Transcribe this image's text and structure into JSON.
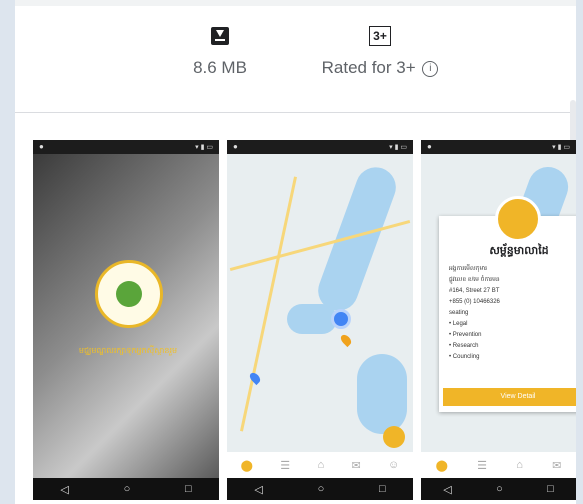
{
  "stats": {
    "size_value": "8.6 MB",
    "rating_badge": "3+",
    "rating_text": "Rated for 3+",
    "info_glyph": "i"
  },
  "shot1": {
    "subtitle": "មជ្ឈមណ្ឌលរក្សាទុកអ្នកស៊ីស្ថានរួម"
  },
  "shot3": {
    "title": "សម្ព័ន្ធមាលាដៃ",
    "lines": [
      "អង្គការមើលកុមារ",
      "ផ្លូវលេខ ខ/មេ ចំការមន",
      "#164, Street 27 BT",
      "+855 (0) 10466326",
      "seating",
      "• Legal",
      "• Prevention",
      "• Research",
      "• Councling"
    ],
    "button": "View Detail"
  },
  "colors": {
    "accent": "#f0b528",
    "map_water": "#aad3f0",
    "pin_blue": "#4285f4"
  }
}
